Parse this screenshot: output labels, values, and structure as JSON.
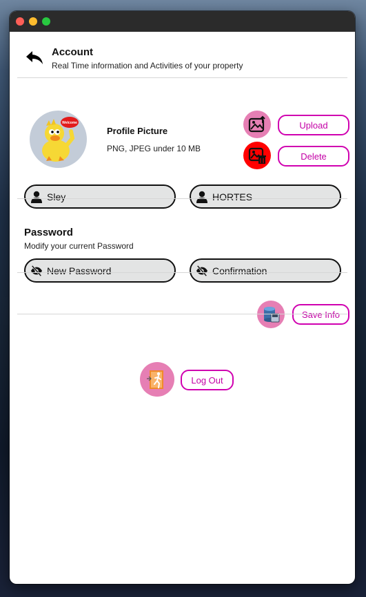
{
  "header": {
    "title": "Account",
    "subtitle": "Real Time information and Activities of your property",
    "back_icon": "back-arrow-icon"
  },
  "profile_picture": {
    "title": "Profile Picture",
    "hint": "PNG, JPEG under 10 MB",
    "avatar_badge_text": "Welcome",
    "upload_label": "Upload",
    "delete_label": "Delete"
  },
  "name_fields": {
    "first_name": "Sley",
    "last_name": "HORTES"
  },
  "password": {
    "title": "Password",
    "subtitle": "Modify your current Password",
    "new_password_placeholder": "New Password",
    "confirmation_placeholder": "Confirmation"
  },
  "actions": {
    "save_label": "Save Info",
    "logout_label": "Log Out"
  },
  "colors": {
    "accent": "#d000b0",
    "icon_bg_pink": "#e67fb4",
    "danger_red": "#ff0000",
    "field_bg": "#e3e4e4"
  }
}
